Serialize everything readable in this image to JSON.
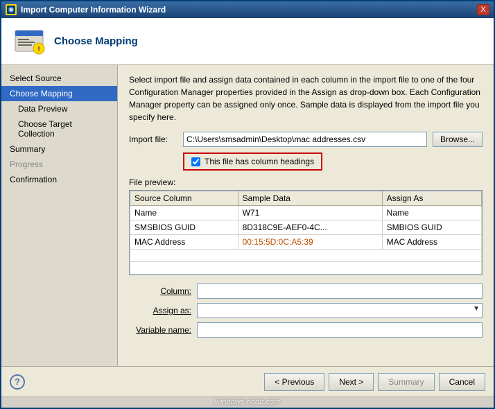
{
  "window": {
    "title": "Import Computer Information Wizard",
    "close_label": "X"
  },
  "header": {
    "title": "Choose Mapping"
  },
  "sidebar": {
    "items": [
      {
        "id": "select-source",
        "label": "Select Source",
        "indent": false,
        "active": false,
        "disabled": false
      },
      {
        "id": "choose-mapping",
        "label": "Choose Mapping",
        "indent": false,
        "active": true,
        "disabled": false
      },
      {
        "id": "data-preview",
        "label": "Data Preview",
        "indent": true,
        "active": false,
        "disabled": false
      },
      {
        "id": "choose-target",
        "label": "Choose Target Collection",
        "indent": true,
        "active": false,
        "disabled": false
      },
      {
        "id": "summary",
        "label": "Summary",
        "indent": false,
        "active": false,
        "disabled": false
      },
      {
        "id": "progress",
        "label": "Progress",
        "indent": false,
        "active": false,
        "disabled": true
      },
      {
        "id": "confirmation",
        "label": "Confirmation",
        "indent": false,
        "active": false,
        "disabled": false
      }
    ]
  },
  "main": {
    "description": "Select import file and assign data contained in each column in the import file to one of the four Configuration Manager properties provided in the Assign as drop-down box. Each Configuration Manager property can be assigned only once. Sample data is displayed from the import file you specify here.",
    "import_file_label": "Import file:",
    "import_file_value": "C:\\Users\\smsadmin\\Desktop\\mac addresses.csv",
    "browse_label": "Browse...",
    "checkbox_label": "This file has column headings",
    "checkbox_checked": true,
    "file_preview_label": "File preview:",
    "table": {
      "headers": [
        "Source Column",
        "Sample Data",
        "Assign As"
      ],
      "rows": [
        {
          "source": "Name",
          "sample": "W71",
          "sample_colored": false,
          "assign": "Name"
        },
        {
          "source": "SMSBIOS GUID",
          "sample": "8D318C9E-AEF0-4C...",
          "sample_colored": false,
          "assign": "SMBIOS GUID"
        },
        {
          "source": "MAC Address",
          "sample": "00:15:5D:0C:A5:39",
          "sample_colored": true,
          "assign": "MAC Address"
        }
      ]
    },
    "column_label": "Column:",
    "assign_as_label": "Assign as:",
    "variable_name_label": "Variable name:"
  },
  "footer": {
    "previous_label": "< Previous",
    "next_label": "Next >",
    "summary_label": "Summary",
    "cancel_label": "Cancel"
  },
  "watermark": "windows-noob.com"
}
